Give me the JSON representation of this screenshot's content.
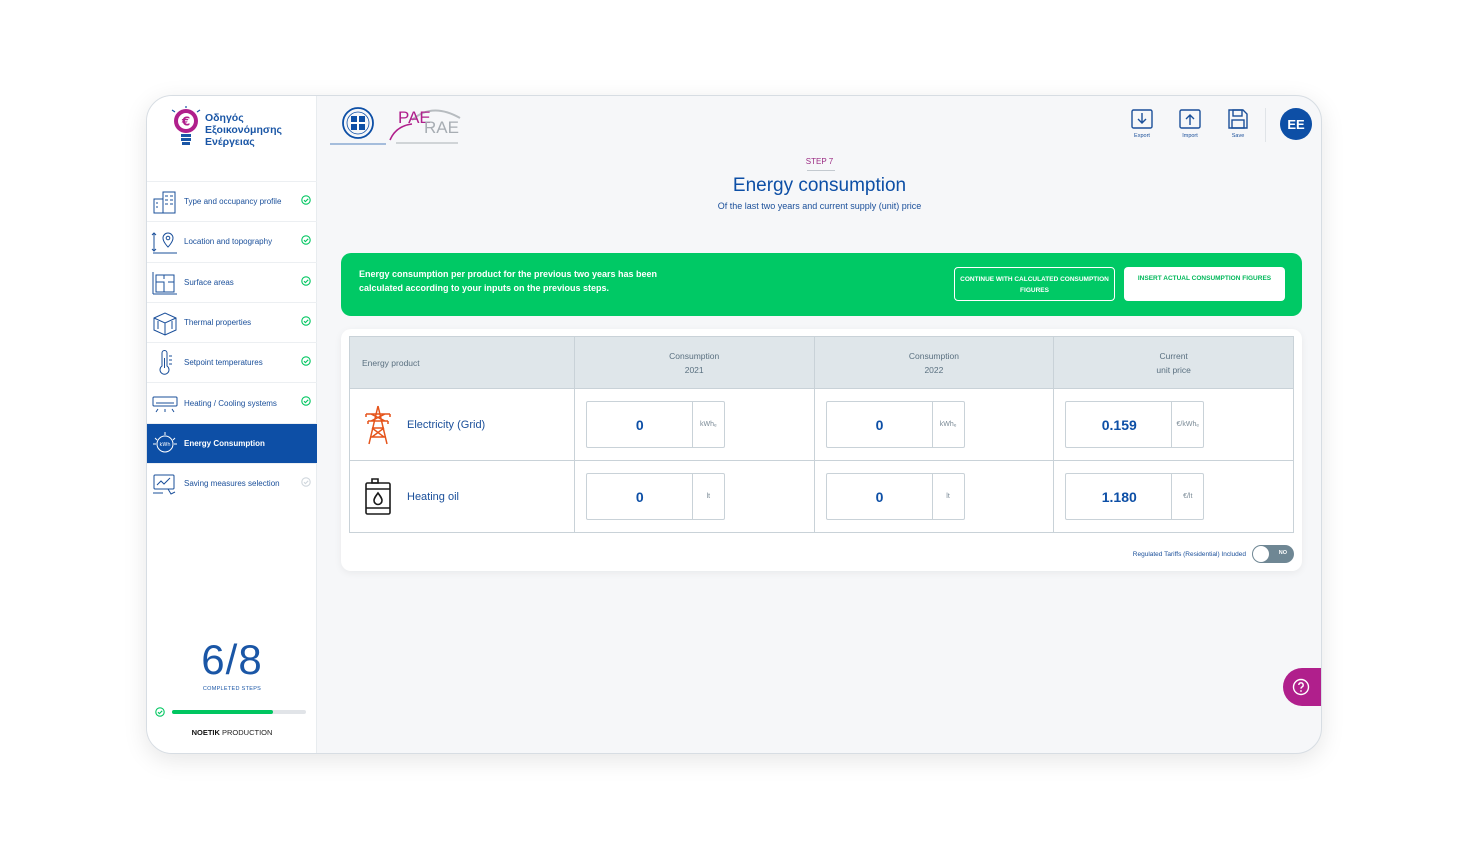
{
  "app": {
    "title_lines": [
      "Οδηγός",
      "Εξοικονόμησης",
      "Ενέργειας"
    ]
  },
  "sidebar": {
    "items": [
      {
        "label": "Type and occupancy profile",
        "icon": "building-icon",
        "done": true
      },
      {
        "label": "Location and topography",
        "icon": "location-pin-icon",
        "done": true
      },
      {
        "label": "Surface areas",
        "icon": "floor-plan-icon",
        "done": true
      },
      {
        "label": "Thermal properties",
        "icon": "insulation-box-icon",
        "done": true
      },
      {
        "label": "Setpoint temperatures",
        "icon": "thermometer-icon",
        "done": true
      },
      {
        "label": "Heating / Cooling systems",
        "icon": "air-conditioner-icon",
        "done": true
      },
      {
        "label": "Energy Consumption",
        "icon": "kwh-meter-icon",
        "done": false,
        "active": true
      },
      {
        "label": "Saving measures selection",
        "icon": "savings-chart-icon",
        "done": false
      }
    ],
    "progress": {
      "text": "6/8",
      "caption": "COMPLETED STEPS",
      "fraction": 0.75
    },
    "credit": {
      "bold": "NOETIK",
      "rest": " PRODUCTION"
    }
  },
  "header": {
    "rae_text": "PAE",
    "rae_text2": "RAE",
    "tools": [
      {
        "label": "Export",
        "icon": "download-icon"
      },
      {
        "label": "Import",
        "icon": "upload-icon"
      },
      {
        "label": "Save",
        "icon": "save-icon"
      }
    ],
    "avatar": "EE"
  },
  "page": {
    "step": "STEP 7",
    "title": "Energy consumption",
    "subtitle": "Of the last two years and current supply (unit) price"
  },
  "banner": {
    "text": "Energy consumption per product for the previous two years has been calculated according to your inputs on the previous steps.",
    "btn_calculated": "CONTINUE WITH CALCULATED CONSUMPTION FIGURES",
    "btn_actual": "INSERT ACTUAL CONSUMPTION FIGURES",
    "color": "#00c965"
  },
  "table": {
    "headers": {
      "product": "Energy product",
      "c2021_a": "Consumption",
      "c2021_b": "2021",
      "c2022_a": "Consumption",
      "c2022_b": "2022",
      "price_a": "Current",
      "price_b": "unit price"
    },
    "rows": [
      {
        "name": "Electricity (Grid)",
        "icon": "power-tower-icon",
        "v2021": "0",
        "u2021": "kWhₑ",
        "v2022": "0",
        "u2022": "kWhₑ",
        "price": "0.159",
        "price_unit": "€/kWhₑ"
      },
      {
        "name": "Heating oil",
        "icon": "oil-barrel-icon",
        "v2021": "0",
        "u2021": "lt",
        "v2022": "0",
        "u2022": "lt",
        "price": "1.180",
        "price_unit": "€/lt"
      }
    ]
  },
  "toggle": {
    "label": "Regulated Tariffs (Residential) Included",
    "state": "NO"
  },
  "colors": {
    "primary": "#0d4fa6",
    "success": "#00c660",
    "accent": "#b01f8c"
  }
}
